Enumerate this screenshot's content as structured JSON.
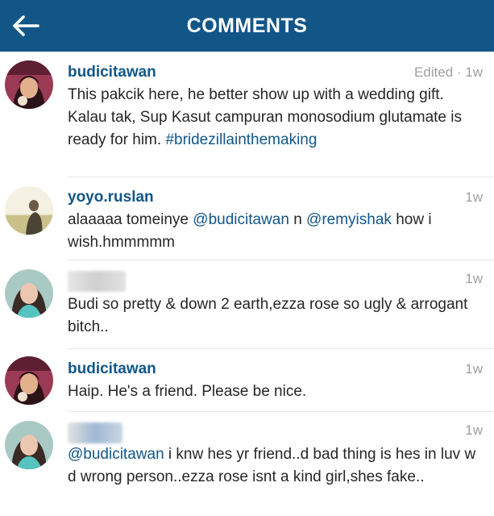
{
  "header": {
    "title": "COMMENTS",
    "back_icon": "arrow-left-icon",
    "background": "#125688"
  },
  "comments": [
    {
      "username": "budicitawan",
      "time": "Edited · 1w",
      "text_parts": [
        "This pakcik here, he better show up with a wedding gift. Kalau tak, Sup Kasut campuran monosodium glutamate is ready for him. ",
        "#bridezillainthemaking"
      ]
    },
    {
      "username": "yoyo.ruslan",
      "time": "1w",
      "text_parts": [
        "alaaaaa tomeinye ",
        "@budicitawan",
        " n ",
        "@remyishak",
        " how i wish.hmmmmm"
      ]
    },
    {
      "username": "",
      "username_obscured": true,
      "time": "1w",
      "text_parts": [
        "Budi so pretty & down 2 earth,ezza rose so ugly & arrogant bitch.."
      ]
    },
    {
      "username": "budicitawan",
      "time": "1w",
      "text_parts": [
        "Haip. He's a friend. Please be nice."
      ]
    },
    {
      "username": "",
      "username_obscured": true,
      "time": "1w",
      "text_parts": [
        "@budicitawan",
        " i knw hes yr friend..d bad thing is hes in luv w d wrong person..ezza rose isnt a kind girl,shes fake.."
      ]
    }
  ]
}
